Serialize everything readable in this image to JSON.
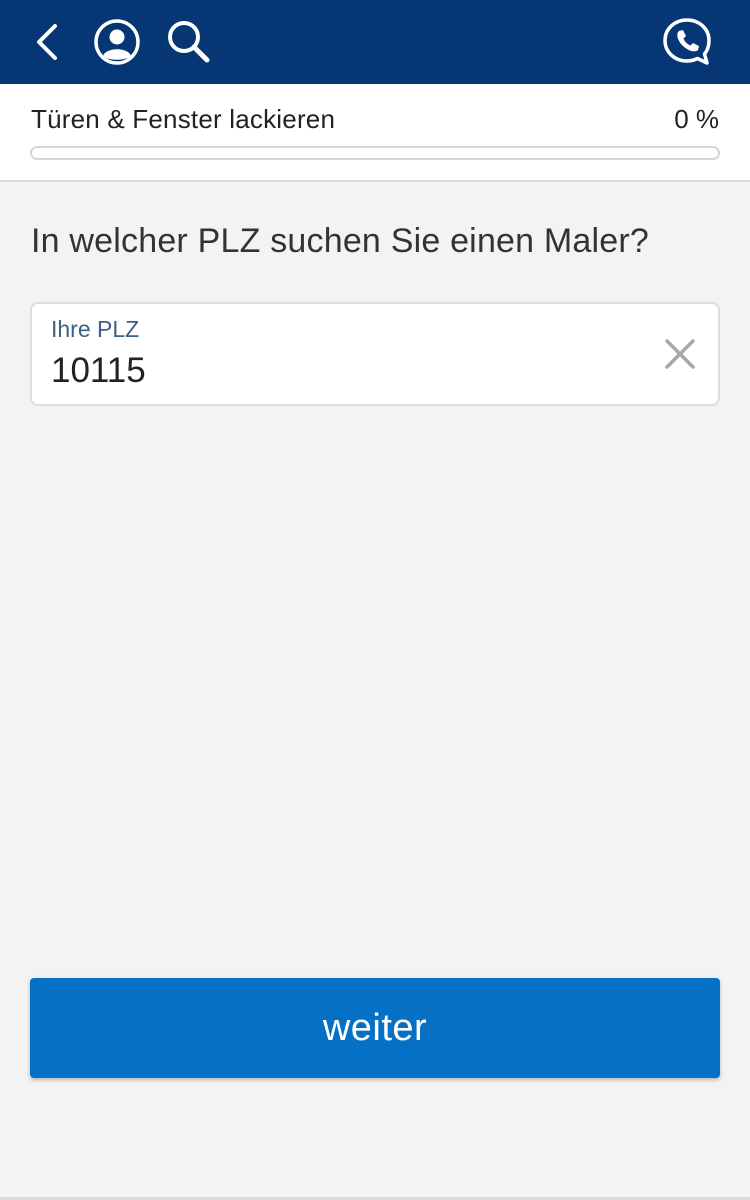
{
  "header": {
    "background_color": "#063673",
    "back_icon": "chevron-left-icon",
    "account_icon": "user-circle-icon",
    "search_icon": "search-icon",
    "phone_icon": "phone-chat-icon"
  },
  "progress": {
    "title": "Türen & Fenster lackieren",
    "percent_label": "0 %",
    "percent_value": 0
  },
  "question": "In welcher PLZ suchen Sie einen Maler?",
  "plz_field": {
    "label": "Ihre PLZ",
    "value": "10115",
    "clear_icon": "close-icon"
  },
  "next_button": {
    "label": "weiter",
    "color": "#0671c4"
  }
}
